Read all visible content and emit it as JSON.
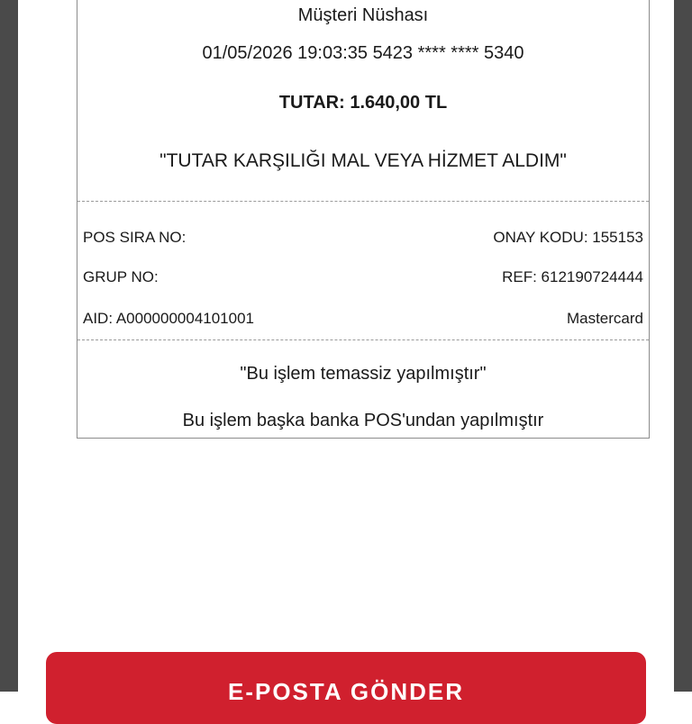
{
  "receipt": {
    "copy_label": "Müşteri Nüshası",
    "transaction_line": "01/05/2026 19:03:35 5423 **** **** 5340",
    "amount": "TUTAR: 1.640,00 TL",
    "declaration": "\"TUTAR KARŞILIĞI MAL VEYA HİZMET ALDIM\"",
    "pos_sira_no_label": "POS SIRA NO:",
    "onay_kodu": "ONAY KODU: 155153",
    "grup_no_label": "GRUP NO:",
    "ref": "REF: 612190724444",
    "aid": "AID: A000000004101001",
    "card_brand": "Mastercard",
    "contactless_note": "\"Bu işlem temassiz yapılmıştır\"",
    "other_bank_note": "Bu işlem başka banka POS'undan yapılmıştır"
  },
  "actions": {
    "email_button_label": "E-POSTA GÖNDER"
  },
  "colors": {
    "accent": "#d0202e",
    "side_panel": "#4a4a4a",
    "border": "#8c8c8c"
  }
}
